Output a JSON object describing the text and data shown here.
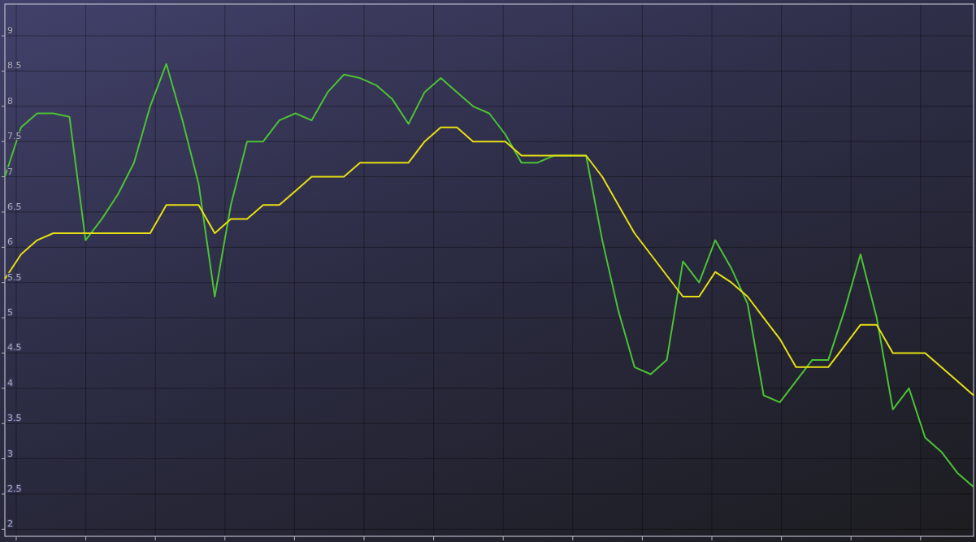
{
  "chart": {
    "chart_data": {
      "type": "line",
      "grid": true,
      "ylim": [
        1.9,
        9.45
      ],
      "yticks": [
        2,
        2.5,
        3,
        3.5,
        4,
        4.5,
        5,
        5.5,
        6,
        6.5,
        7,
        7.5,
        8,
        8.5,
        9
      ],
      "series": [
        {
          "color": "#4cc234",
          "values": [
            7.0,
            7.7,
            7.9,
            7.9,
            7.85,
            6.1,
            6.4,
            6.75,
            7.2,
            8.0,
            8.6,
            7.8,
            6.9,
            5.3,
            6.6,
            7.5,
            7.5,
            7.8,
            7.9,
            7.8,
            8.2,
            8.45,
            8.4,
            8.3,
            8.1,
            7.75,
            8.2,
            8.4,
            8.2,
            8.0,
            7.9,
            7.6,
            7.2,
            7.2,
            7.3,
            7.3,
            7.3,
            6.1,
            5.1,
            4.3,
            4.2,
            4.4,
            5.8,
            5.5,
            6.1,
            5.7,
            5.2,
            3.9,
            3.8,
            4.1,
            4.4,
            4.4,
            5.1,
            5.9,
            5.0,
            3.7,
            4.0,
            3.3,
            3.1,
            2.8,
            2.6
          ]
        },
        {
          "color": "#e6e012",
          "values": [
            5.55,
            5.9,
            6.1,
            6.2,
            6.2,
            6.2,
            6.2,
            6.2,
            6.2,
            6.2,
            6.6,
            6.6,
            6.6,
            6.2,
            6.4,
            6.4,
            6.6,
            6.6,
            6.8,
            7.0,
            7.0,
            7.0,
            7.2,
            7.2,
            7.2,
            7.2,
            7.5,
            7.7,
            7.7,
            7.5,
            7.5,
            7.5,
            7.3,
            7.3,
            7.3,
            7.3,
            7.3,
            7.0,
            6.6,
            6.2,
            5.9,
            5.6,
            5.3,
            5.3,
            5.65,
            5.5,
            5.3,
            5.0,
            4.7,
            4.3,
            4.3,
            4.3,
            4.6,
            4.9,
            4.9,
            4.5,
            4.5,
            4.5,
            4.3,
            4.1,
            3.9
          ]
        }
      ]
    }
  }
}
